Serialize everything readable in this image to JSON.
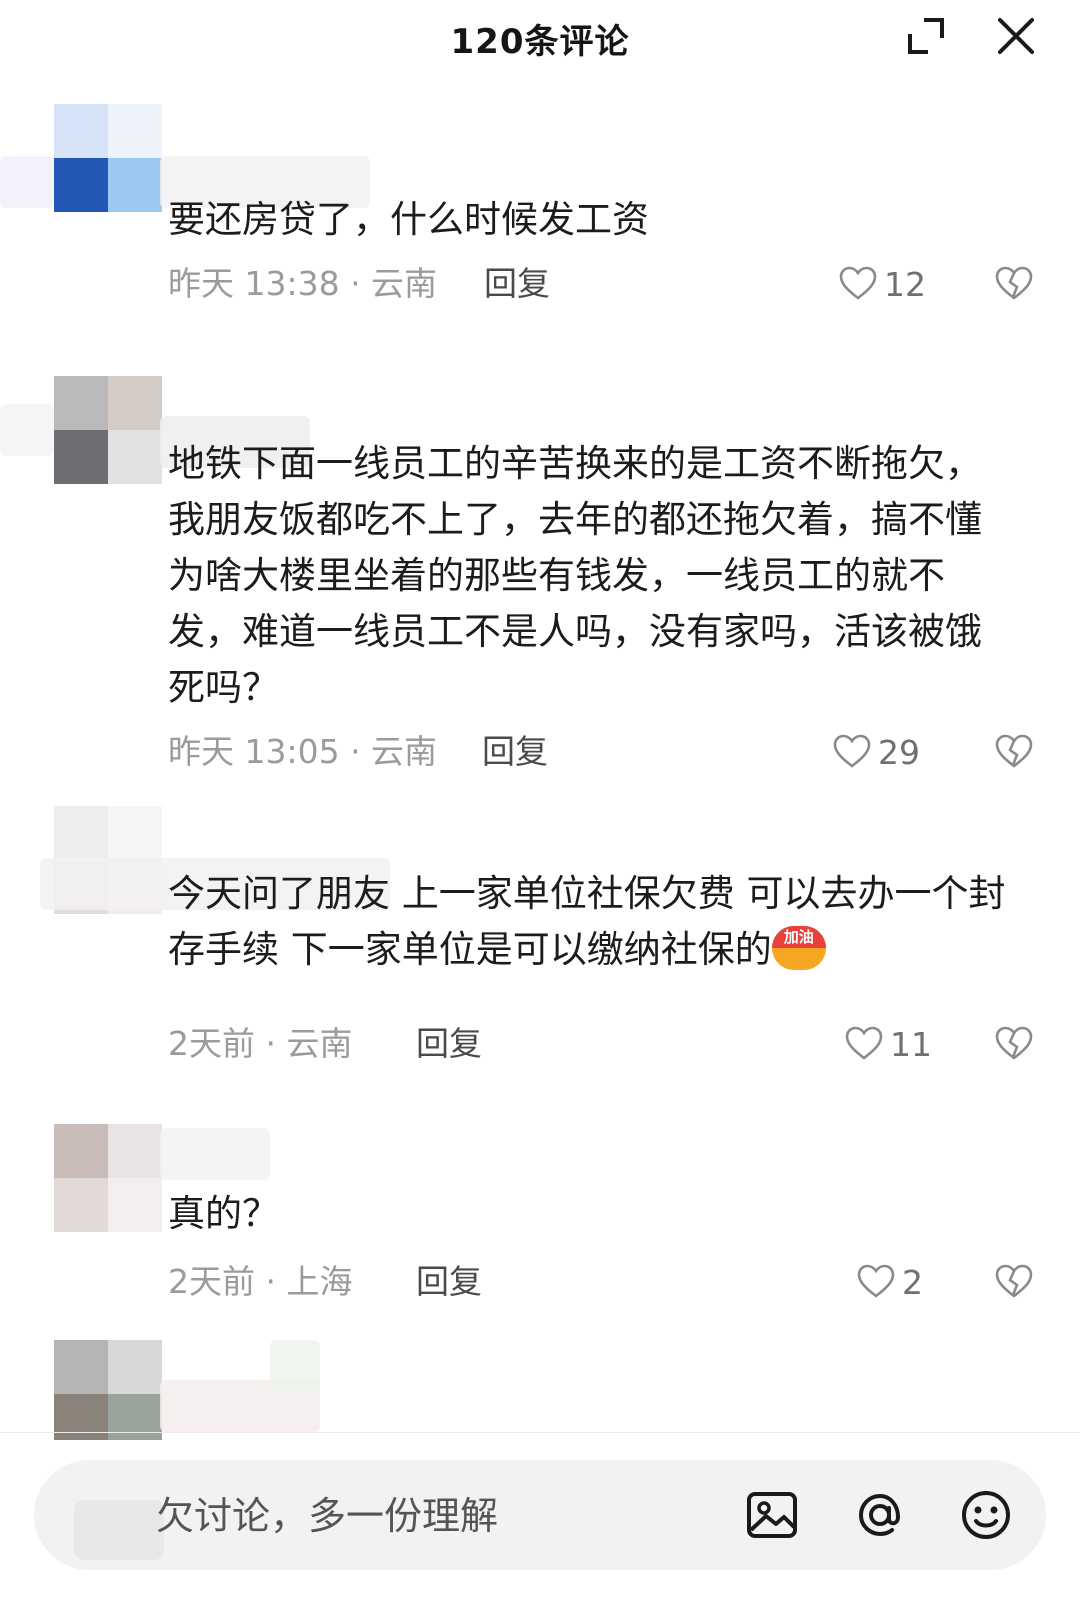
{
  "header": {
    "title": "120条评论",
    "icons": {
      "expand": "expand-icon",
      "close": "close-icon"
    }
  },
  "comments": [
    {
      "text": "要还房贷了，什么时候发工资",
      "meta": "昨天 13:38 · 云南",
      "reply": "回复",
      "likes": "12"
    },
    {
      "text": "地铁下面一线员工的辛苦换来的是工资不断拖欠，我朋友饭都吃不上了，去年的都还拖欠着，搞不懂为啥大楼里坐着的那些有钱发，一线员工的就不发，难道一线员工不是人吗，没有家吗，活该被饿死吗？",
      "meta": "昨天 13:05 · 云南",
      "reply": "回复",
      "likes": "29"
    },
    {
      "text": "今天问了朋友 上一家单位社保欠费 可以去办一个封存手续 下一家单位是可以缴纳社保的",
      "sticker": "加油",
      "meta": "2天前 · 云南",
      "reply": "回复",
      "likes": "11"
    },
    {
      "text": "真的？",
      "meta": "2天前 · 上海",
      "reply": "回复",
      "likes": "2"
    }
  ],
  "input": {
    "placeholder": "欠讨论，多一份理解",
    "icons": {
      "image": "image-icon",
      "mention": "at-mention-icon",
      "emoji": "emoji-icon"
    }
  },
  "colors": {
    "text": "#1c1c1c",
    "meta": "#9b9b9b",
    "reply": "#4a4a4a",
    "icon": "#8a8a8a",
    "input_bg": "#f2f2f2"
  }
}
